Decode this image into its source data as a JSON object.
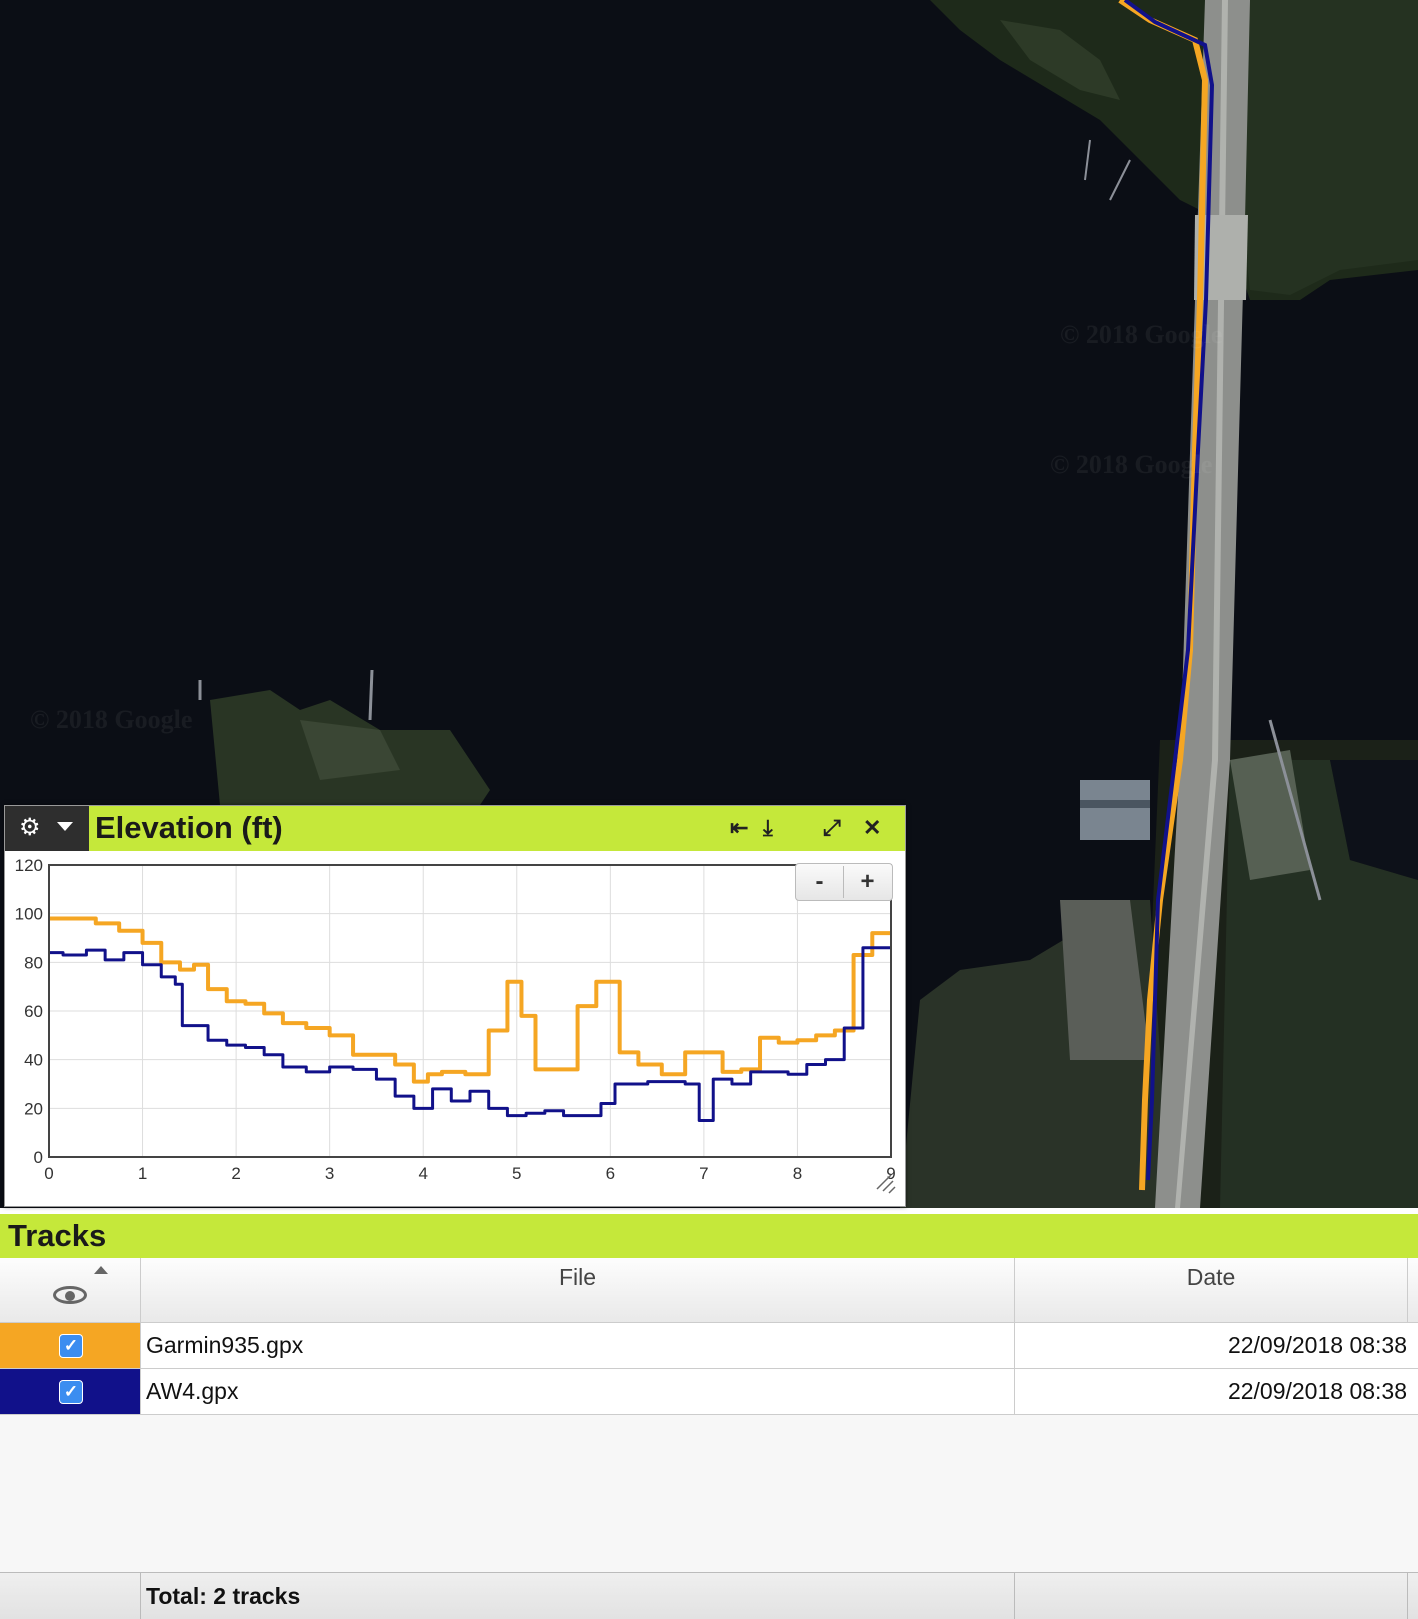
{
  "map": {
    "watermark": "© 2018 Google"
  },
  "elevation_panel": {
    "title": "Elevation (ft)",
    "icons": [
      "gear-icon",
      "chevron-down-icon",
      "fit-left-icon",
      "download-icon",
      "expand-icon",
      "close-icon"
    ],
    "zoom_out_label": "-",
    "zoom_in_label": "+"
  },
  "chart_data": {
    "type": "line",
    "title": "Elevation (ft)",
    "xlabel": "",
    "ylabel": "",
    "xlim": [
      0,
      9
    ],
    "ylim": [
      0,
      120
    ],
    "x_ticks": [
      "0",
      "1",
      "2",
      "3",
      "4",
      "5",
      "6",
      "7",
      "8",
      "9"
    ],
    "y_ticks": [
      "0",
      "20",
      "40",
      "60",
      "80",
      "100",
      "120"
    ],
    "grid": true,
    "series": [
      {
        "color": "#f5a623",
        "x": [
          0,
          0.4,
          0.6,
          0.9,
          1.1,
          1.3,
          1.5,
          1.6,
          1.8,
          2.0,
          2.2,
          2.4,
          2.6,
          2.9,
          3.1,
          3.4,
          3.6,
          3.8,
          4.0,
          4.1,
          4.3,
          4.6,
          4.8,
          5.0,
          5.1,
          5.3,
          5.5,
          5.8,
          5.9,
          6.0,
          6.2,
          6.4,
          6.7,
          6.9,
          7.1,
          7.3,
          7.5,
          7.7,
          7.9,
          8.1,
          8.3,
          8.5,
          8.7,
          8.9,
          9.0
        ],
        "y": [
          98,
          98,
          96,
          93,
          88,
          80,
          77,
          79,
          69,
          64,
          63,
          59,
          55,
          53,
          50,
          42,
          42,
          38,
          31,
          34,
          35,
          34,
          52,
          72,
          58,
          36,
          36,
          62,
          72,
          72,
          43,
          38,
          34,
          43,
          43,
          35,
          36,
          49,
          47,
          48,
          50,
          52,
          83,
          92,
          92
        ]
      },
      {
        "color": "#11118a",
        "x": [
          0,
          0.3,
          0.5,
          0.7,
          0.9,
          1.1,
          1.3,
          1.4,
          1.45,
          1.6,
          1.8,
          2.0,
          2.2,
          2.4,
          2.6,
          2.9,
          3.1,
          3.4,
          3.6,
          3.8,
          4.0,
          4.2,
          4.4,
          4.6,
          4.8,
          5.0,
          5.2,
          5.4,
          5.6,
          5.8,
          6.0,
          6.1,
          6.3,
          6.5,
          6.7,
          6.9,
          7.0,
          7.2,
          7.4,
          7.6,
          7.8,
          8.0,
          8.2,
          8.4,
          8.6,
          8.8,
          9.0
        ],
        "y": [
          84,
          83,
          85,
          81,
          84,
          79,
          74,
          71,
          54,
          54,
          48,
          46,
          45,
          42,
          37,
          35,
          37,
          36,
          32,
          25,
          20,
          28,
          23,
          27,
          20,
          17,
          18,
          19,
          17,
          17,
          22,
          30,
          30,
          31,
          31,
          30,
          15,
          32,
          30,
          35,
          35,
          34,
          38,
          40,
          53,
          86,
          86
        ]
      }
    ]
  },
  "tracks": {
    "title": "Tracks",
    "columns": [
      "File",
      "Date"
    ],
    "rows": [
      {
        "color": "#f5a623",
        "visible": true,
        "file": "Garmin935.gpx",
        "date": "22/09/2018 08:38"
      },
      {
        "color": "#11118a",
        "visible": true,
        "file": "AW4.gpx",
        "date": "22/09/2018 08:38"
      }
    ],
    "footer_total": "Total: 2 tracks",
    "checkbox_glyph": "✓"
  }
}
